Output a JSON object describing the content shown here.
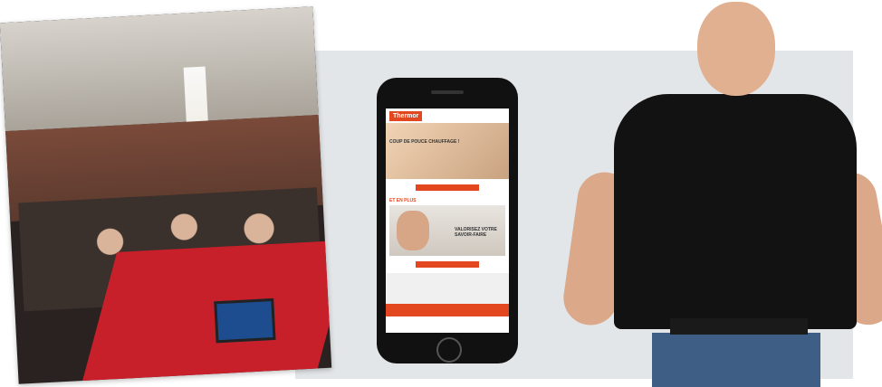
{
  "phone_screen": {
    "brand": "Thermor",
    "hero_headline": "COUP DE POUCE CHAUFFAGE !",
    "section_label": "ET EN PLUS",
    "promo_text": "VALORISEZ VOTRE SAVOIR-FAIRE"
  }
}
